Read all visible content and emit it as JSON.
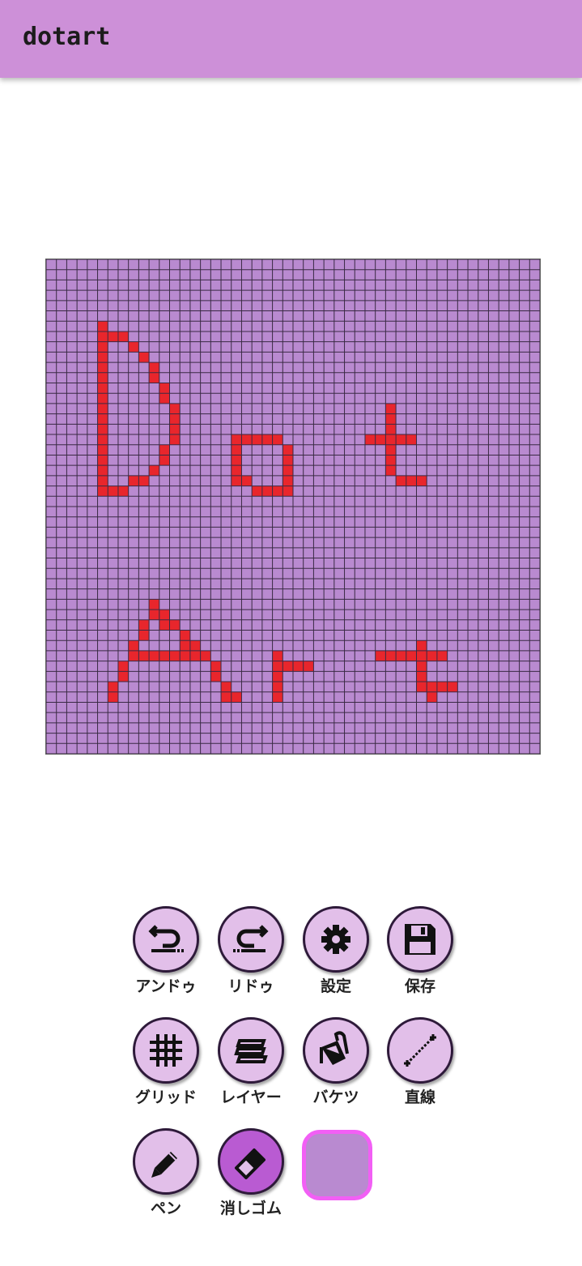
{
  "app": {
    "title": "dotart"
  },
  "canvas": {
    "grid_size": 48,
    "background_color": "#b98ad0",
    "pixel_color": "#e8262c",
    "grid_line_color": "#3a2a44",
    "text_drawn": "Dot Art"
  },
  "toolbar": {
    "undo": {
      "label": "アンドゥ",
      "icon": "undo-icon"
    },
    "redo": {
      "label": "リドゥ",
      "icon": "redo-icon"
    },
    "settings": {
      "label": "設定",
      "icon": "gear-icon"
    },
    "save": {
      "label": "保存",
      "icon": "floppy-disk-icon"
    },
    "grid": {
      "label": "グリッド",
      "icon": "grid-icon"
    },
    "layer": {
      "label": "レイヤー",
      "icon": "layers-icon"
    },
    "bucket": {
      "label": "バケツ",
      "icon": "paint-bucket-icon"
    },
    "line": {
      "label": "直線",
      "icon": "line-icon"
    },
    "pen": {
      "label": "ペン",
      "icon": "pencil-icon"
    },
    "eraser": {
      "label": "消しゴム",
      "icon": "eraser-icon",
      "selected": true
    }
  },
  "color_swatch": {
    "fill": "#b98ad0",
    "border": "#f25ff5"
  },
  "colors": {
    "app_bar": "#cd90d8",
    "button_bg": "#e2bfe9",
    "button_active": "#b95bd2"
  }
}
